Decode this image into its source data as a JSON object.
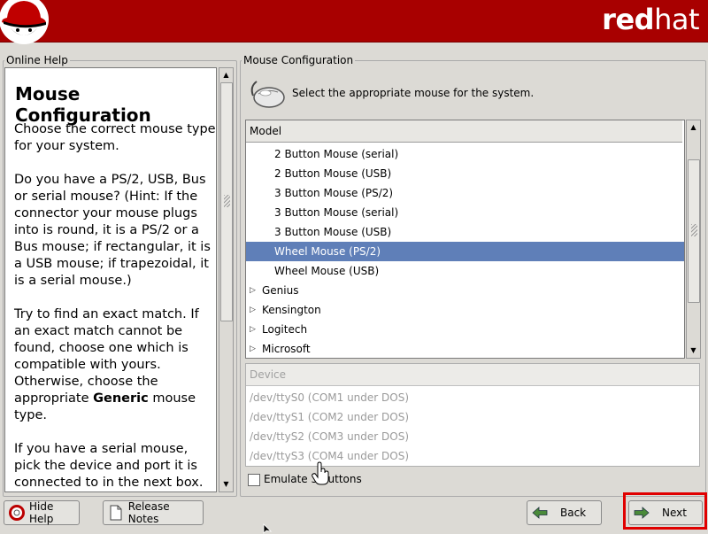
{
  "banner": {
    "brand_bold": "red",
    "brand_light": "hat"
  },
  "help": {
    "frame_label": "Online Help",
    "title": "Mouse Configuration",
    "paragraphs": [
      "Choose the correct mouse type for your system.",
      "Do you have a PS/2, USB, Bus or serial mouse? (Hint: If the connector your mouse plugs into is round, it is a PS/2 or a Bus mouse; if rectangular, it is a USB mouse; if trapezoidal, it is a serial mouse.)",
      "Try to find an exact match. If an exact match cannot be found, choose one which is compatible with yours. Otherwise, choose the appropriate",
      "mouse type.",
      "If you have a serial mouse, pick the device and port it is connected to in the next box."
    ],
    "generic_word": "Generic"
  },
  "mouse_config": {
    "frame_label": "Mouse Configuration",
    "instruction": "Select the appropriate mouse for the system.",
    "model_header": "Model",
    "models": [
      {
        "label": "2 Button Mouse (serial)",
        "level": 1,
        "selected": false
      },
      {
        "label": "2 Button Mouse (USB)",
        "level": 1,
        "selected": false
      },
      {
        "label": "3 Button Mouse (PS/2)",
        "level": 1,
        "selected": false
      },
      {
        "label": "3 Button Mouse (serial)",
        "level": 1,
        "selected": false
      },
      {
        "label": "3 Button Mouse (USB)",
        "level": 1,
        "selected": false
      },
      {
        "label": "Wheel Mouse (PS/2)",
        "level": 1,
        "selected": true
      },
      {
        "label": "Wheel Mouse (USB)",
        "level": 1,
        "selected": false
      },
      {
        "label": "Genius",
        "level": 0,
        "selected": false
      },
      {
        "label": "Kensington",
        "level": 0,
        "selected": false
      },
      {
        "label": "Logitech",
        "level": 0,
        "selected": false
      },
      {
        "label": "Microsoft",
        "level": 0,
        "selected": false
      }
    ],
    "device_header": "Device",
    "devices": [
      "/dev/ttyS0 (COM1 under DOS)",
      "/dev/ttyS1 (COM2 under DOS)",
      "/dev/ttyS2 (COM3 under DOS)",
      "/dev/ttyS3 (COM4 under DOS)"
    ],
    "emulate_label": "Emulate 3 buttons",
    "emulate_checked": false
  },
  "buttons": {
    "hide_help": "Hide Help",
    "release_notes": "Release Notes",
    "back": "Back",
    "next": "Next"
  },
  "colors": {
    "banner": "#a80000",
    "selection": "#5f7fb8",
    "highlight_outline": "#e00000"
  }
}
